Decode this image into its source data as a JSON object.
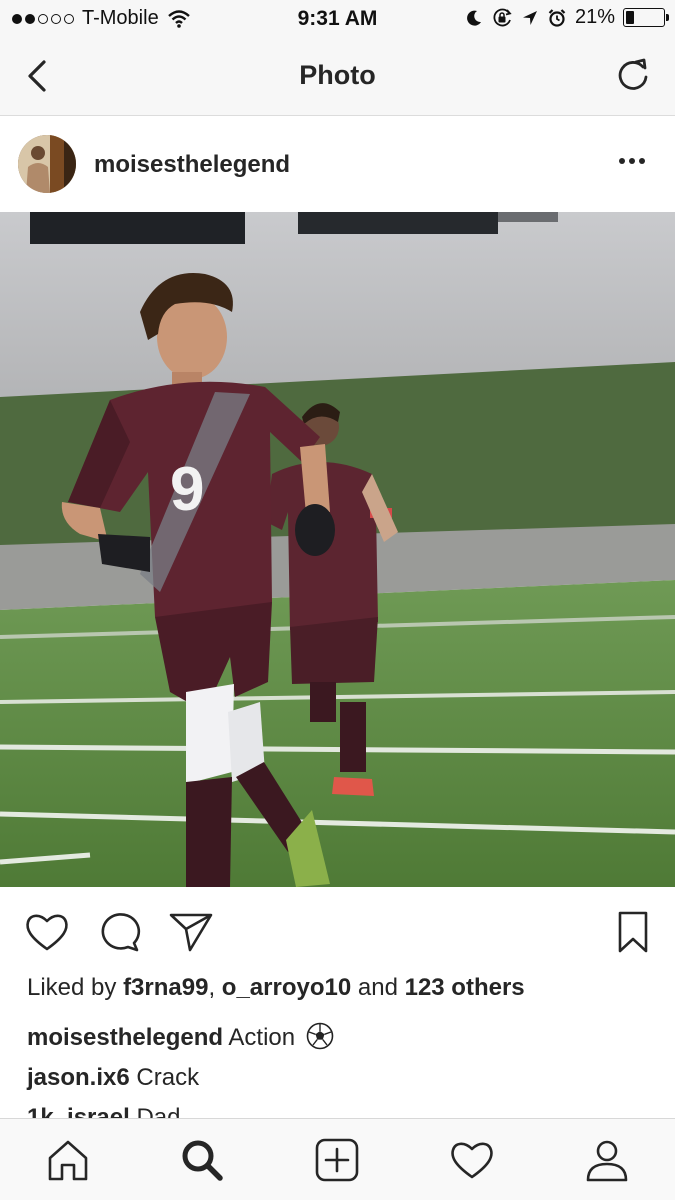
{
  "status_bar": {
    "carrier": "T-Mobile",
    "time": "9:31 AM",
    "battery_percent": "21%",
    "battery_level": 0.21,
    "signal_bars_filled": 2,
    "signal_bars_total": 5,
    "icons": [
      "wifi-icon",
      "moon-icon",
      "orientation-lock-icon",
      "location-icon",
      "alarm-icon",
      "battery-icon"
    ]
  },
  "nav": {
    "title": "Photo",
    "back_icon": "chevron-left-icon",
    "refresh_icon": "refresh-icon"
  },
  "post": {
    "username": "moisesthelegend",
    "more_icon": "ellipsis-icon",
    "image_description_icon": "photo"
  },
  "actions": {
    "like_icon": "heart-icon",
    "comment_icon": "comment-icon",
    "share_icon": "send-icon",
    "save_icon": "bookmark-icon"
  },
  "likes": {
    "prefix": "Liked by",
    "user1": "f3rna99",
    "separator": ",",
    "user2": "o_arroyo10",
    "and": "and",
    "others": "123 others"
  },
  "caption": {
    "username": "moisesthelegend",
    "text": "Action"
  },
  "comments": [
    {
      "username": "jason.ix6",
      "text": "Crack"
    },
    {
      "username": "1k_israel",
      "text": "Dad"
    }
  ],
  "tab_bar": {
    "items": [
      "home-icon",
      "search-icon",
      "add-post-icon",
      "activity-heart-icon",
      "profile-icon"
    ],
    "active": "search-icon"
  }
}
